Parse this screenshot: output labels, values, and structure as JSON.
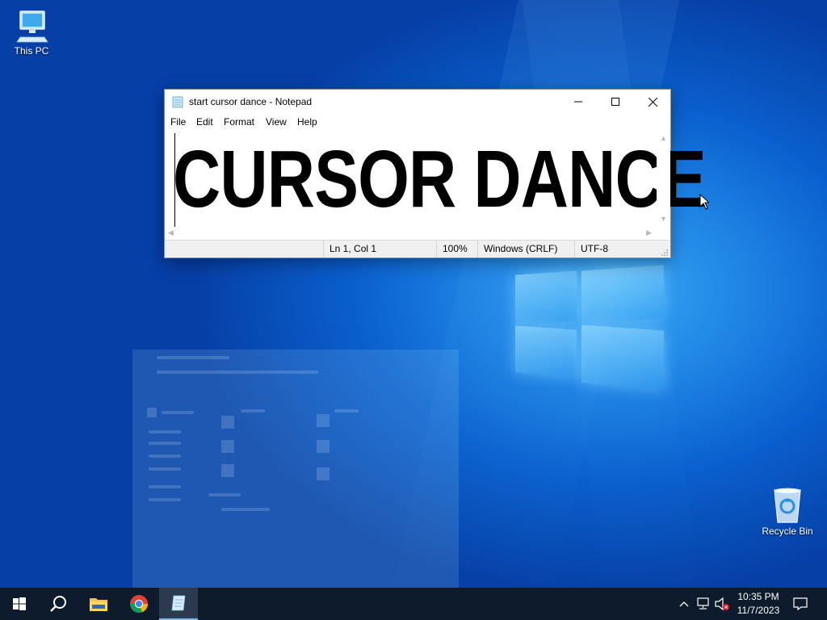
{
  "desktop": {
    "icons": [
      {
        "label": "This PC",
        "icon": "this-pc-icon"
      },
      {
        "label": "Recycle Bin",
        "icon": "recycle-bin-icon"
      }
    ]
  },
  "notepad": {
    "title": "start cursor dance - Notepad",
    "menu": [
      "File",
      "Edit",
      "Format",
      "View",
      "Help"
    ],
    "content": "CURSOR DANCE",
    "status": {
      "position": "Ln 1, Col 1",
      "zoom": "100%",
      "line_ending": "Windows (CRLF)",
      "encoding": "UTF-8"
    }
  },
  "taskbar": {
    "apps": [
      "start-icon",
      "search-icon",
      "file-explorer-icon",
      "chrome-icon",
      "notepad-icon"
    ],
    "active_app": "notepad-icon",
    "clock": {
      "time": "10:35 PM",
      "date": "11/7/2023"
    },
    "tray": [
      "chevron-up-icon",
      "network-icon",
      "volume-muted-icon",
      "notification-icon"
    ]
  },
  "colors": {
    "desktop_blue": "#0a5fcd",
    "taskbar": "#0e1b2c",
    "active_underline": "#76b9ed"
  }
}
